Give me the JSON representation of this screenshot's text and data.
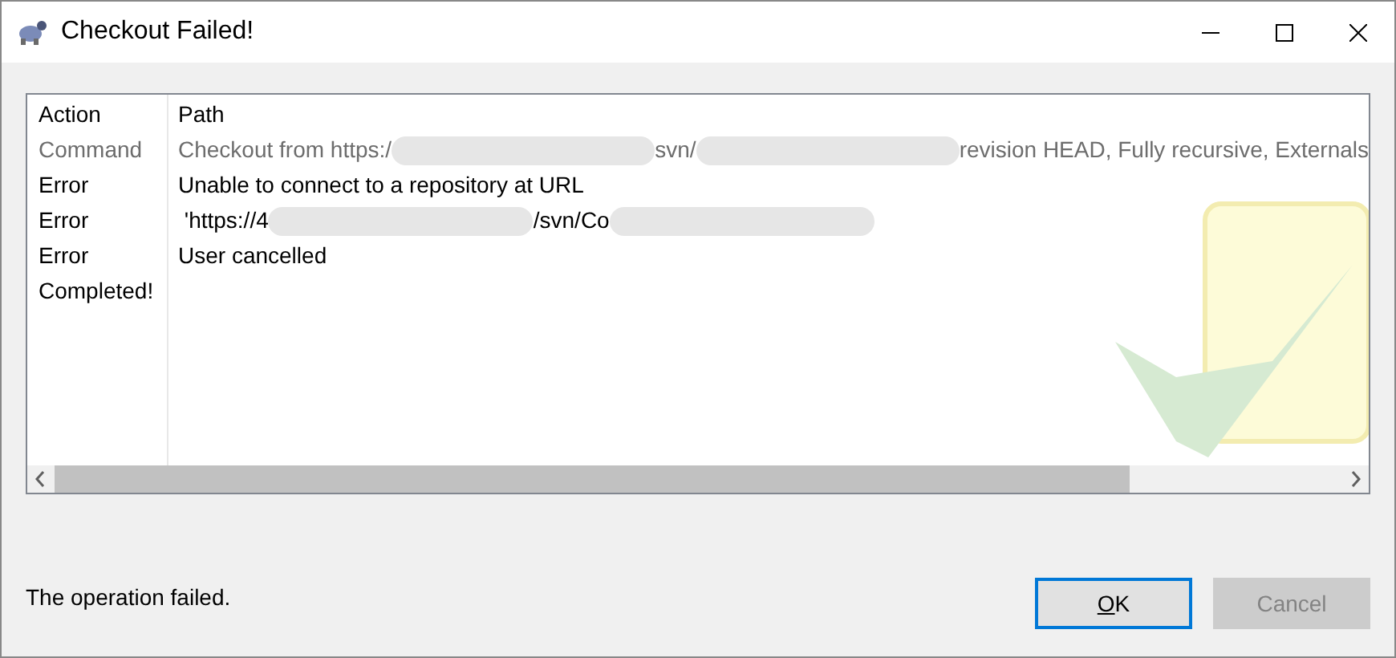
{
  "window": {
    "title": "Checkout Failed!"
  },
  "table": {
    "columns": [
      "Action",
      "Path"
    ],
    "rows": [
      {
        "action": "Command",
        "dimmed": true,
        "path": [
          {
            "kind": "text",
            "text": "Checkout from https:/"
          },
          {
            "kind": "redacted"
          },
          {
            "kind": "text",
            "text": "svn/"
          },
          {
            "kind": "redacted"
          },
          {
            "kind": "text",
            "text": "revision HEAD, Fully recursive, Externals"
          }
        ]
      },
      {
        "action": "Error",
        "dimmed": false,
        "path": [
          {
            "kind": "text",
            "text": "Unable to connect to a repository at URL"
          }
        ]
      },
      {
        "action": "Error",
        "dimmed": false,
        "path": [
          {
            "kind": "text",
            "text": " 'https://4"
          },
          {
            "kind": "redacted"
          },
          {
            "kind": "text",
            "text": "/svn/Co"
          },
          {
            "kind": "redacted"
          }
        ]
      },
      {
        "action": "Error",
        "dimmed": false,
        "path": [
          {
            "kind": "text",
            "text": "User cancelled"
          }
        ]
      },
      {
        "action": "Completed!",
        "dimmed": false,
        "path": []
      }
    ]
  },
  "status": "The operation failed.",
  "buttons": [
    {
      "label": "OK",
      "default": true,
      "underline_first": true,
      "disabled": false
    },
    {
      "label": "Cancel",
      "default": false,
      "underline_first": false,
      "disabled": true
    }
  ]
}
